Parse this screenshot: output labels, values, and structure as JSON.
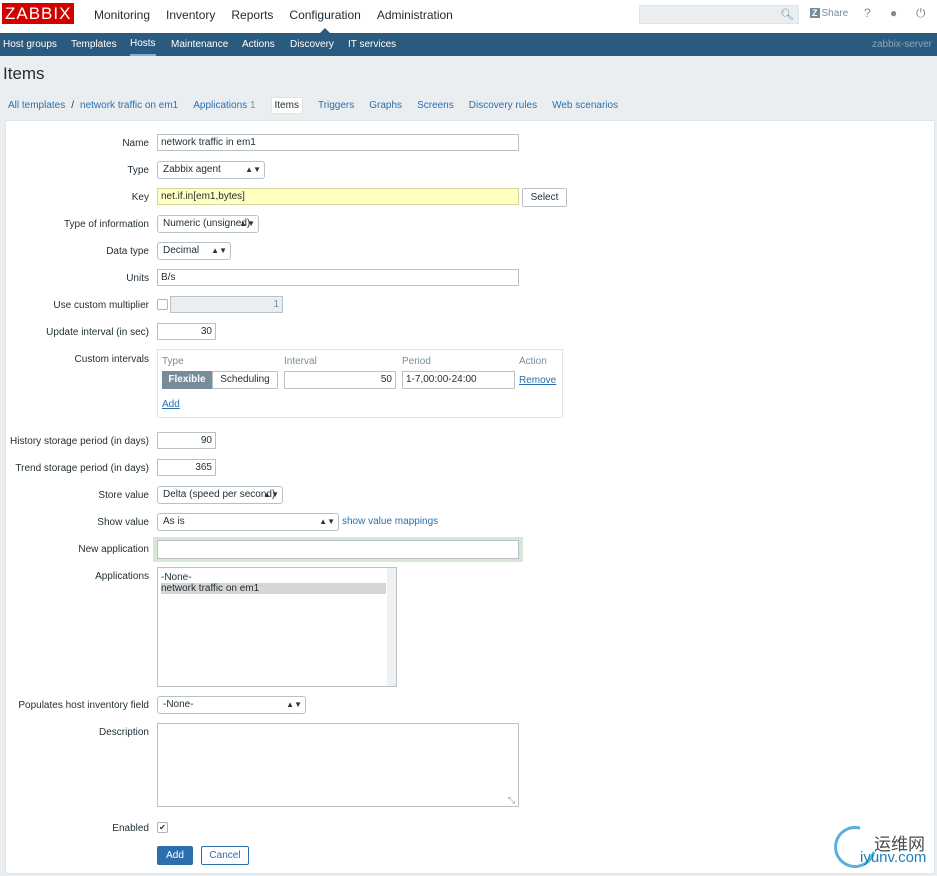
{
  "topbar": {
    "logo": "ZABBIX",
    "nav": [
      "Monitoring",
      "Inventory",
      "Reports",
      "Configuration",
      "Administration"
    ],
    "active_nav": "Configuration",
    "share_icon_text": "Z",
    "share_label": "Share",
    "help_symbol": "?",
    "user_symbol": "●",
    "power_symbol": "⏻"
  },
  "subnav": {
    "items": [
      "Host groups",
      "Templates",
      "Hosts",
      "Maintenance",
      "Actions",
      "Discovery",
      "IT services"
    ],
    "active": "Hosts",
    "server": "zabbix-server"
  },
  "page_title": "Items",
  "breadcrumb": {
    "all_templates": "All templates",
    "separator": "/",
    "host": "network traffic on em1",
    "tabs": [
      {
        "label": "Applications",
        "count": "1"
      },
      {
        "label": "Items"
      },
      {
        "label": "Triggers"
      },
      {
        "label": "Graphs"
      },
      {
        "label": "Screens"
      },
      {
        "label": "Discovery rules"
      },
      {
        "label": "Web scenarios"
      }
    ],
    "active_tab": "Items"
  },
  "form": {
    "name_label": "Name",
    "name_value": "network traffic in em1",
    "type_label": "Type",
    "type_value": "Zabbix agent",
    "key_label": "Key",
    "key_value": "net.if.in[em1,bytes]",
    "key_select_button": "Select",
    "type_info_label": "Type of information",
    "type_info_value": "Numeric (unsigned)",
    "data_type_label": "Data type",
    "data_type_value": "Decimal",
    "units_label": "Units",
    "units_value": "B/s",
    "multiplier_label": "Use custom multiplier",
    "multiplier_value": "1",
    "multiplier_checked": false,
    "update_label": "Update interval (in sec)",
    "update_value": "30",
    "custom_intervals_label": "Custom intervals",
    "custom_intervals": {
      "headers": {
        "type": "Type",
        "interval": "Interval",
        "period": "Period",
        "action": "Action"
      },
      "flexible": "Flexible",
      "scheduling": "Scheduling",
      "interval_value": "50",
      "period_value": "1-7,00:00-24:00",
      "remove": "Remove",
      "add": "Add"
    },
    "history_label": "History storage period (in days)",
    "history_value": "90",
    "trend_label": "Trend storage period (in days)",
    "trend_value": "365",
    "store_label": "Store value",
    "store_value": "Delta (speed per second)",
    "show_label": "Show value",
    "show_value": "As is",
    "show_mappings_link": "show value mappings",
    "new_app_label": "New application",
    "new_app_value": "",
    "applications_label": "Applications",
    "applications": [
      "-None-",
      "network traffic on em1"
    ],
    "applications_selected": "network traffic on em1",
    "inventory_label": "Populates host inventory field",
    "inventory_value": "-None-",
    "description_label": "Description",
    "description_value": "",
    "enabled_label": "Enabled",
    "enabled_checked": true,
    "add_button": "Add",
    "cancel_button": "Cancel"
  },
  "watermark": {
    "cn": "运维网",
    "en": "iyunv.com"
  },
  "colors": {
    "brand_red": "#d40000",
    "nav_blue": "#2b5a7f",
    "link_blue": "#2b6fae",
    "key_highlight": "#ffffc0",
    "focus_green": "#d5e8d4"
  }
}
